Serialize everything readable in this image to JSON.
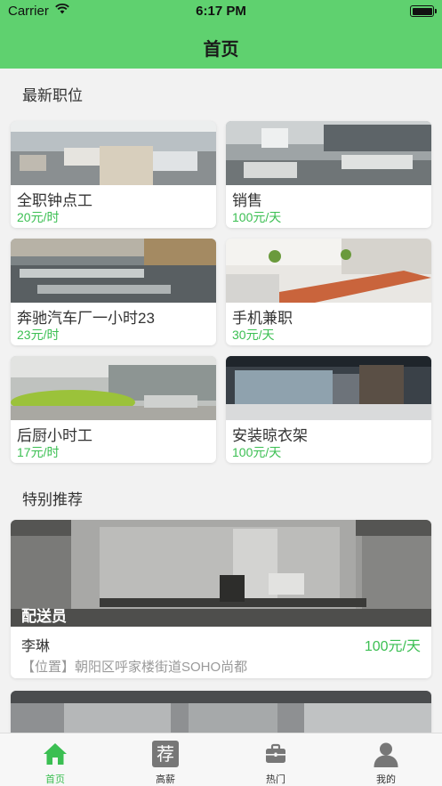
{
  "status_bar": {
    "carrier": "Carrier",
    "time": "6:17 PM"
  },
  "nav": {
    "title": "首页"
  },
  "latest": {
    "title": "最新职位",
    "jobs": [
      {
        "name": "全职钟点工",
        "price": "20元/时"
      },
      {
        "name": "销售",
        "price": "100元/天"
      },
      {
        "name": "奔驰汽车厂一小时23",
        "price": "23元/时"
      },
      {
        "name": "手机兼职",
        "price": "30元/天"
      },
      {
        "name": "后厨小时工",
        "price": "17元/时"
      },
      {
        "name": "安装晾衣架",
        "price": "100元/天"
      }
    ]
  },
  "featured": {
    "title": "特别推荐",
    "items": [
      {
        "role": "配送员",
        "person": "李琳",
        "wage": "100元/天",
        "location": "【位置】朝阳区呼家楼街道SOHO尚都"
      }
    ]
  },
  "tabbar": {
    "tabs": [
      {
        "label": "首页",
        "icon": "home-icon"
      },
      {
        "label": "高薪",
        "icon": "recommend-icon",
        "glyph": "荐"
      },
      {
        "label": "热门",
        "icon": "briefcase-icon"
      },
      {
        "label": "我的",
        "icon": "user-icon"
      }
    ]
  },
  "colors": {
    "primary": "#5fd16f",
    "price": "#3bbf52"
  }
}
